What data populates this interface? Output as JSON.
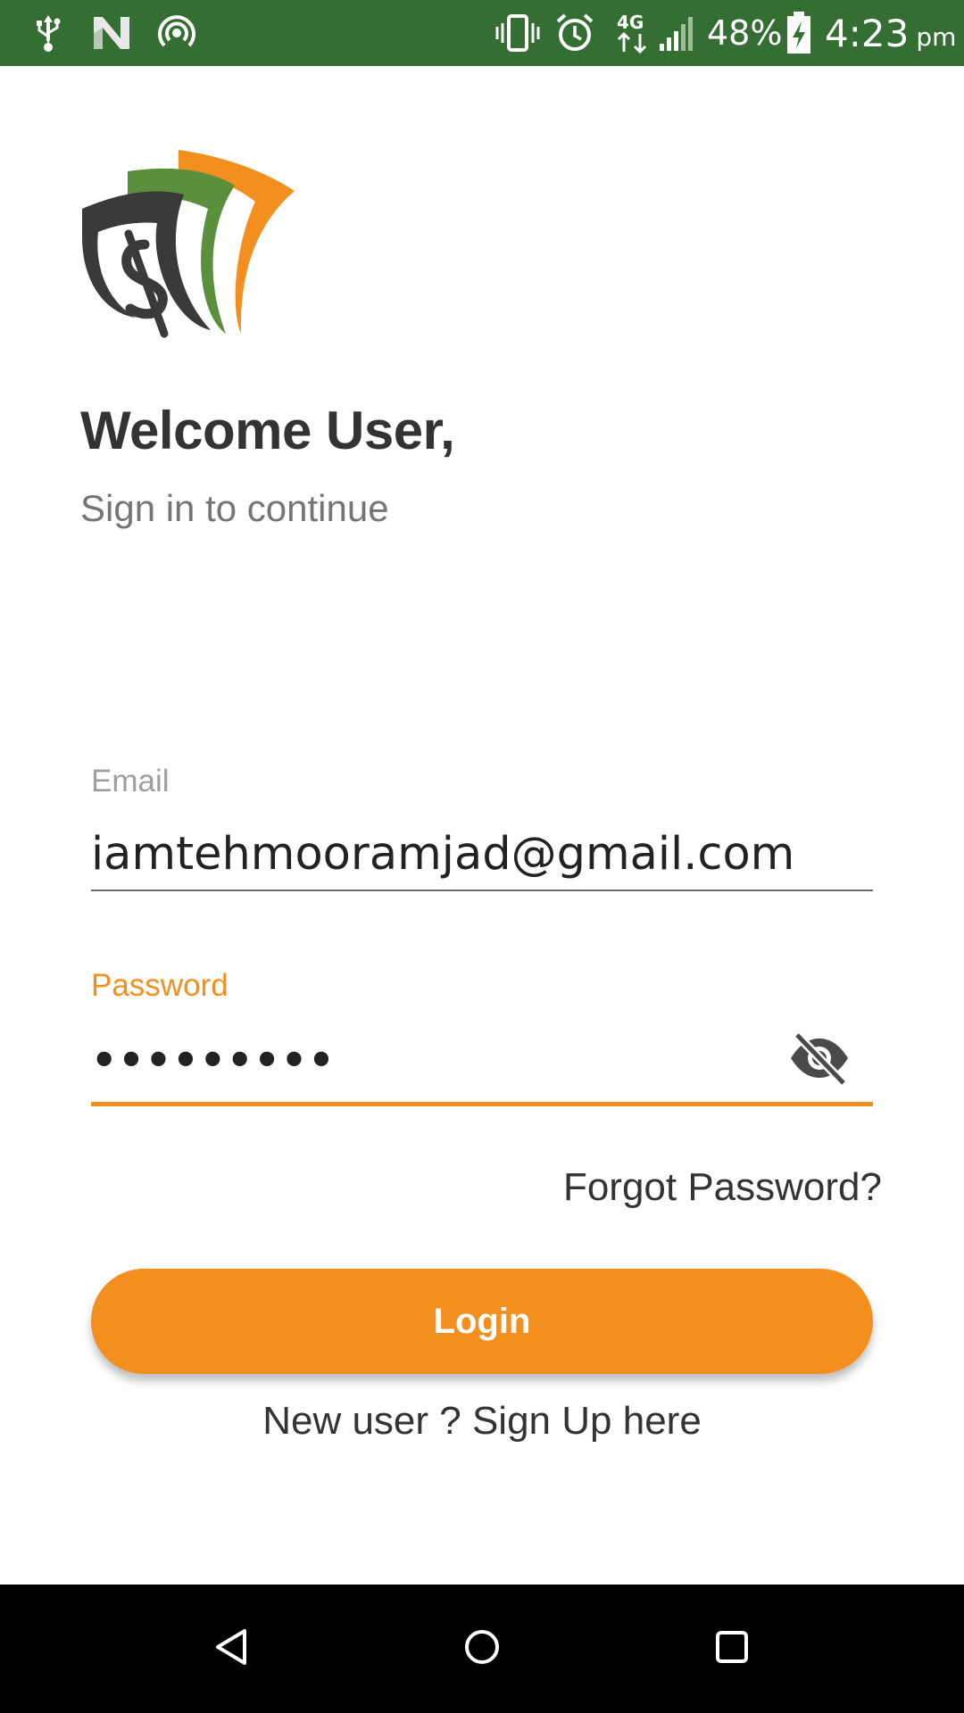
{
  "status_bar": {
    "battery_percent": "48%",
    "time": "4:23",
    "ampm": "pm",
    "background_color": "#356e33",
    "icons": [
      "usb-icon",
      "n-notification-icon",
      "hotspot-icon",
      "vibrate-icon",
      "alarm-icon",
      "4g-data-icon",
      "signal-icon",
      "battery-charging-icon"
    ]
  },
  "header": {
    "title": "Welcome User,",
    "subtitle": "Sign in to continue"
  },
  "form": {
    "email_label": "Email",
    "email_value": "iamtehmooramjad@gmail.com",
    "password_label": "Password",
    "password_value": "•••••••••",
    "password_visibility_icon": "eye-off-icon",
    "forgot_password": "Forgot Password?",
    "login_label": "Login",
    "signup_text": "New user ? Sign Up here"
  },
  "colors": {
    "accent": "#f28f1f",
    "logo_green": "#5a8f3c",
    "logo_dark": "#3a3a3a"
  },
  "nav_bar": {
    "buttons": [
      "back-icon",
      "home-icon",
      "recents-icon"
    ]
  }
}
